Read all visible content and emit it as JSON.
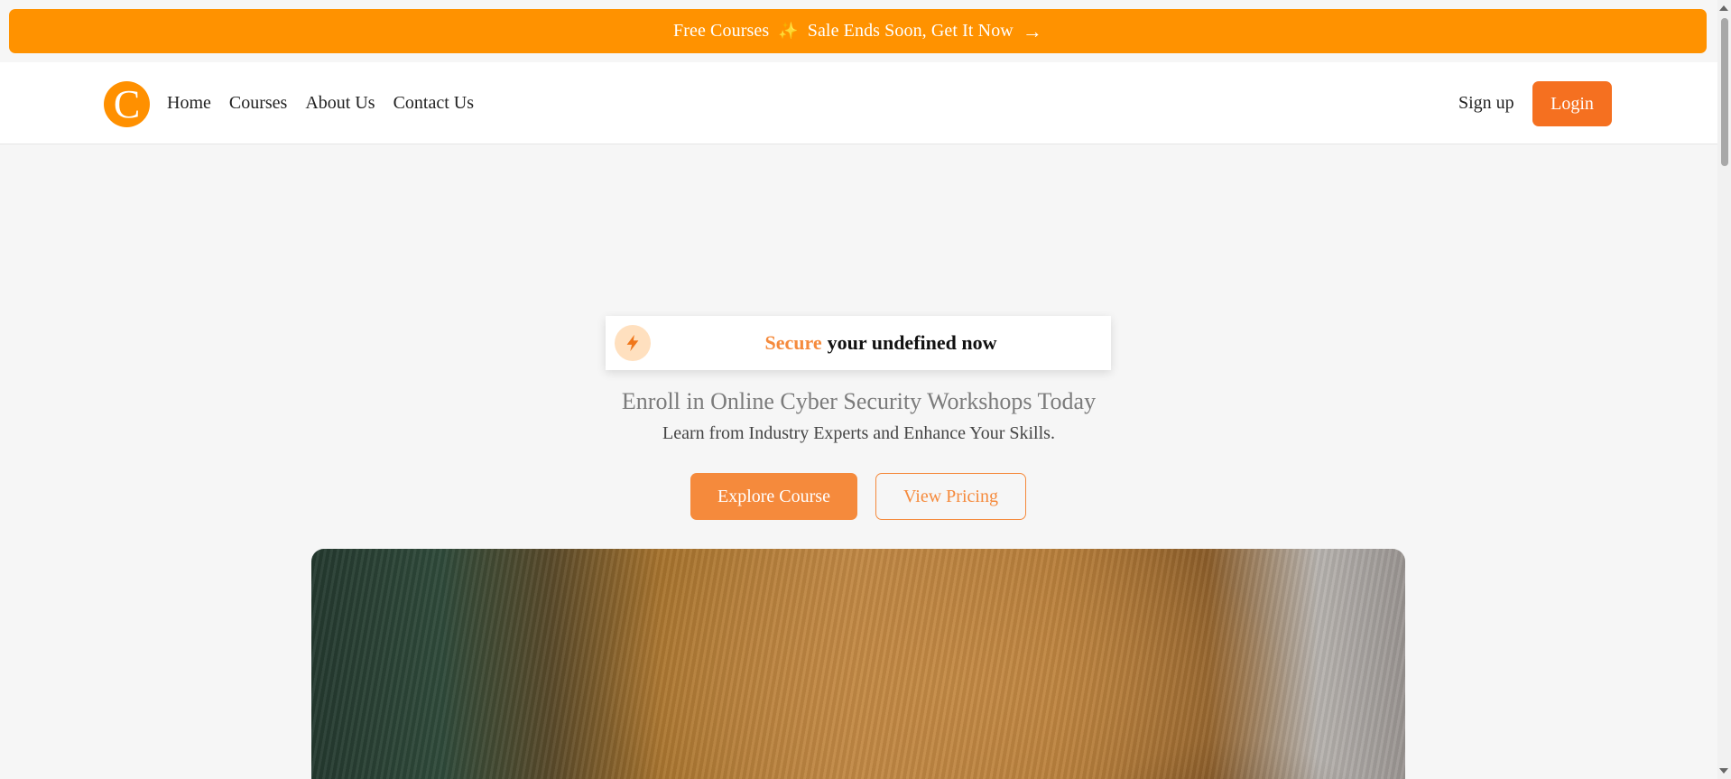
{
  "promo": {
    "text_before": "Free Courses",
    "spark_icon": "✨",
    "text_after": "Sale Ends Soon, Get It Now",
    "arrow": "→"
  },
  "header": {
    "logo_letter": "C",
    "nav": [
      "Home",
      "Courses",
      "About Us",
      "Contact Us"
    ],
    "signup_label": "Sign up",
    "login_label": "Login"
  },
  "hero": {
    "badge_accent": "Secure",
    "badge_text": "your undefined now",
    "headline": "Enroll in Online Cyber Security Workshops Today",
    "subheadline": "Learn from Industry Experts and Enhance Your Skills.",
    "primary_cta": "Explore Course",
    "secondary_cta": "View Pricing"
  },
  "colors": {
    "promo_bg": "#ff9200",
    "accent": "#f58a3c",
    "login_bg": "#f57020",
    "page_bg": "#f6f6f6"
  }
}
